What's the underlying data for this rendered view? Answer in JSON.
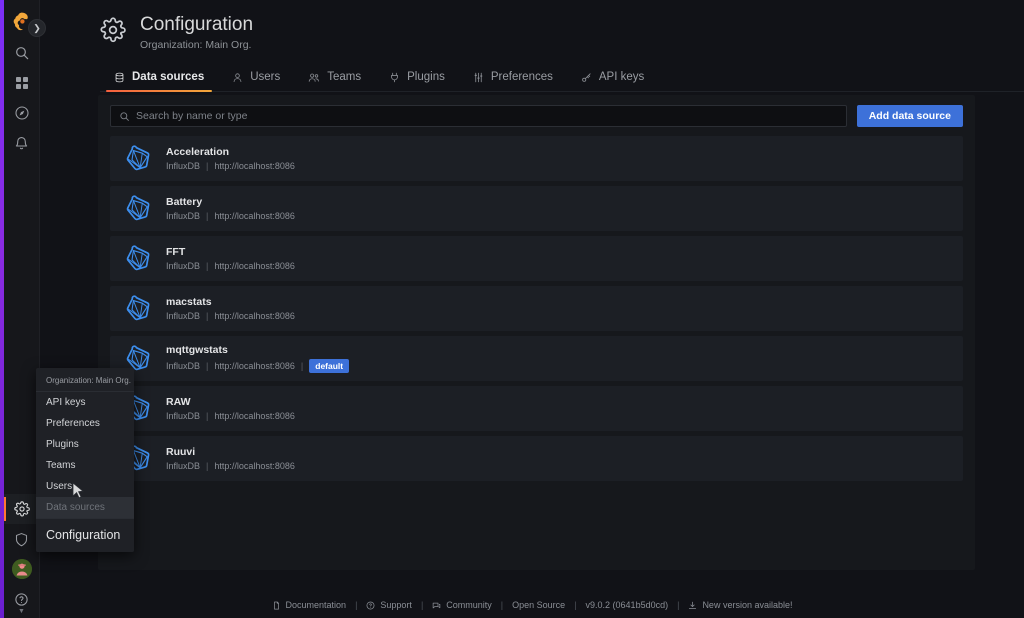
{
  "sidenav": {
    "logo": "grafana-logo-icon",
    "toggle_label": "❯",
    "top_items": [
      {
        "name": "search-icon",
        "label": "Search"
      },
      {
        "name": "dashboards-icon",
        "label": "Dashboards"
      },
      {
        "name": "compass-explore-icon",
        "label": "Explore"
      },
      {
        "name": "bell-alerting-icon",
        "label": "Alerting"
      }
    ],
    "bottom_items": [
      {
        "name": "gear-configuration-icon",
        "label": "Configuration",
        "active": true
      },
      {
        "name": "shield-admin-icon",
        "label": "Server Admin",
        "active": false
      },
      {
        "name": "user-avatar-icon",
        "label": "Profile",
        "active": false
      },
      {
        "name": "help-question-icon",
        "label": "Help",
        "active": false
      }
    ]
  },
  "header": {
    "icon": "gear-icon",
    "title": "Configuration",
    "subtitle": "Organization: Main Org."
  },
  "tabs": [
    {
      "label": "Data sources",
      "icon": "database-icon",
      "active": true
    },
    {
      "label": "Users",
      "icon": "user-icon",
      "active": false
    },
    {
      "label": "Teams",
      "icon": "users-group-icon",
      "active": false
    },
    {
      "label": "Plugins",
      "icon": "plug-icon",
      "active": false
    },
    {
      "label": "Preferences",
      "icon": "sliders-icon",
      "active": false
    },
    {
      "label": "API keys",
      "icon": "key-icon",
      "active": false
    }
  ],
  "toolbar": {
    "search_placeholder": "Search by name or type",
    "search_value": "",
    "search_icon": "search-icon",
    "add_button_label": "Add data source"
  },
  "datasources": [
    {
      "name": "Acceleration",
      "type": "InfluxDB",
      "url": "http://localhost:8086",
      "default": false,
      "icon": "influxdb-icon"
    },
    {
      "name": "Battery",
      "type": "InfluxDB",
      "url": "http://localhost:8086",
      "default": false,
      "icon": "influxdb-icon"
    },
    {
      "name": "FFT",
      "type": "InfluxDB",
      "url": "http://localhost:8086",
      "default": false,
      "icon": "influxdb-icon"
    },
    {
      "name": "macstats",
      "type": "InfluxDB",
      "url": "http://localhost:8086",
      "default": false,
      "icon": "influxdb-icon"
    },
    {
      "name": "mqttgwstats",
      "type": "InfluxDB",
      "url": "http://localhost:8086",
      "default": true,
      "icon": "influxdb-icon"
    },
    {
      "name": "RAW",
      "type": "InfluxDB",
      "url": "http://localhost:8086",
      "default": false,
      "icon": "influxdb-icon"
    },
    {
      "name": "Ruuvi",
      "type": "InfluxDB",
      "url": "http://localhost:8086",
      "default": false,
      "icon": "influxdb-icon"
    }
  ],
  "badges": {
    "default_label": "default"
  },
  "separators": {
    "pipe": "|"
  },
  "flyout": {
    "org_label": "Organization: Main Org.",
    "items": [
      {
        "label": "API keys",
        "highlight": false
      },
      {
        "label": "Preferences",
        "highlight": false
      },
      {
        "label": "Plugins",
        "highlight": false
      },
      {
        "label": "Teams",
        "highlight": false
      },
      {
        "label": "Users",
        "highlight": false
      },
      {
        "label": "Data sources",
        "highlight": true
      }
    ],
    "footer_label": "Configuration"
  },
  "footer": {
    "items": [
      {
        "label": "Documentation",
        "icon": "document-icon"
      },
      {
        "label": "Support",
        "icon": "question-circle-icon"
      },
      {
        "label": "Community",
        "icon": "comments-icon"
      },
      {
        "label": "Open Source",
        "icon": ""
      },
      {
        "label": "v9.0.2 (0641b5d0cd)",
        "icon": ""
      },
      {
        "label": "New version available!",
        "icon": "download-icon"
      }
    ],
    "separator": "|"
  },
  "colors": {
    "page_background": "#111217",
    "panel_background": "#16181c",
    "row_background": "#1c1f25",
    "accent_orange": "#ff7733",
    "accent_blue": "#3d71d9",
    "influx_blue": "#3d8fef",
    "edge_purple": "#8a2be2",
    "text_primary": "#d8d9da",
    "text_secondary": "#8a8e95"
  }
}
